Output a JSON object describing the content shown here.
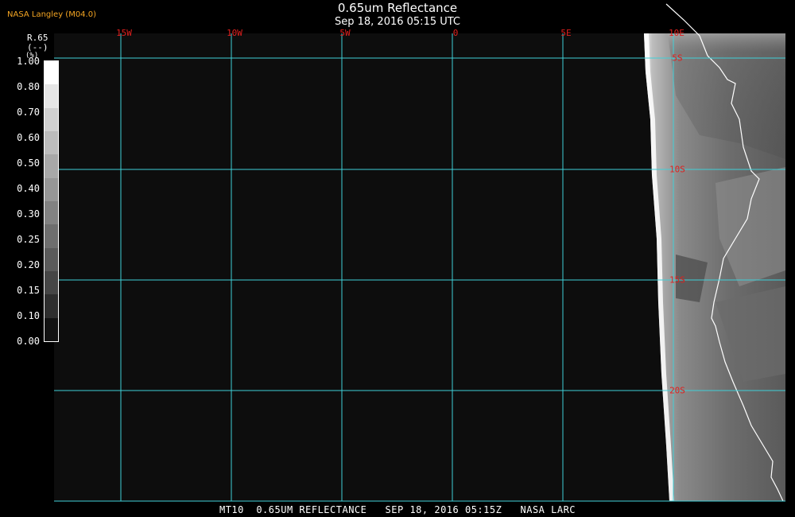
{
  "header": {
    "title": "0.65um Reflectance",
    "subtitle": "Sep 18, 2016 05:15 UTC",
    "provider": "NASA Langley (M04.0)"
  },
  "footer": {
    "caption": "MT10  0.65UM REFLECTANCE   SEP 18, 2016 05:15Z   NASA LARC"
  },
  "colorbar": {
    "name": "R.65",
    "unit": "(%)",
    "unit2": "(--)",
    "ticks": [
      "1.00",
      "0.80",
      "0.70",
      "0.60",
      "0.50",
      "0.40",
      "0.30",
      "0.25",
      "0.20",
      "0.15",
      "0.10",
      "0.00"
    ],
    "colors": [
      "#ffffff",
      "#e6e6e6",
      "#d0d0d0",
      "#bcbcbc",
      "#a8a8a8",
      "#969696",
      "#828282",
      "#6e6e6e",
      "#5a5a5a",
      "#464646",
      "#2e2e2e",
      "#121212"
    ]
  },
  "map": {
    "longitude_labels": [
      "15W",
      "10W",
      "5W",
      "0",
      "5E",
      "10E"
    ],
    "latitude_labels": [
      "5S",
      "10S",
      "15S",
      "20S"
    ],
    "grid_color": "#3fd0d8",
    "label_color": "#e0201e",
    "background": "#0d0d0d"
  }
}
